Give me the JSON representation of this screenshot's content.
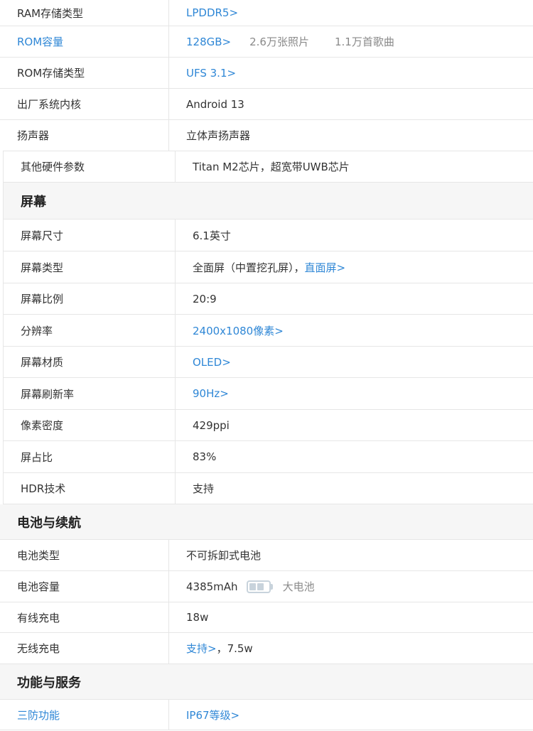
{
  "block1": [
    {
      "label": "RAM存储类型",
      "label_blue": false,
      "value": "LPDDR5>",
      "value_blue": true
    },
    {
      "label": "ROM容量",
      "label_blue": true,
      "value": "128GB>",
      "value_blue": true,
      "extra1": "2.6万张照片",
      "extra2": "1.1万首歌曲"
    },
    {
      "label": "ROM存储类型",
      "label_blue": false,
      "value": "UFS 3.1>",
      "value_blue": true
    },
    {
      "label": "出厂系统内核",
      "label_blue": false,
      "value": "Android 13",
      "value_blue": false
    },
    {
      "label": "扬声器",
      "label_blue": false,
      "value": "立体声扬声器",
      "value_blue": false
    }
  ],
  "block2": {
    "other_label": "其他硬件参数",
    "other_value": "Titan M2芯片，超宽带UWB芯片",
    "section_title": "屏幕",
    "rows": [
      {
        "label": "屏幕尺寸",
        "value": "6.1英寸"
      },
      {
        "label": "屏幕类型",
        "value": "全面屏（中置挖孔屏），",
        "link": "直面屏>"
      },
      {
        "label": "屏幕比例",
        "value": "20:9"
      },
      {
        "label": "分辨率",
        "link": "2400x1080像素>"
      },
      {
        "label": "屏幕材质",
        "link": "OLED>"
      },
      {
        "label": "屏幕刷新率",
        "link": "90Hz>"
      },
      {
        "label": "像素密度",
        "value": "429ppi"
      },
      {
        "label": "屏占比",
        "value": "83%"
      },
      {
        "label": "HDR技术",
        "value": "支持"
      }
    ]
  },
  "block3": {
    "battery_title": "电池与续航",
    "battery_rows": {
      "type_label": "电池类型",
      "type_value": "不可拆卸式电池",
      "capacity_label": "电池容量",
      "capacity_value": "4385mAh",
      "capacity_note": "大电池",
      "capacity_icon": "battery-icon",
      "wired_label": "有线充电",
      "wired_value": "18w",
      "wireless_label": "无线充电",
      "wireless_link": "支持>",
      "wireless_value": "，7.5w"
    },
    "service_title": "功能与服务",
    "protection_label": "三防功能",
    "protection_value": "IP67等级>"
  },
  "colors": {
    "link": "#2f87d6",
    "section_bg": "#f6f6f6",
    "border": "#e6e6e6"
  }
}
